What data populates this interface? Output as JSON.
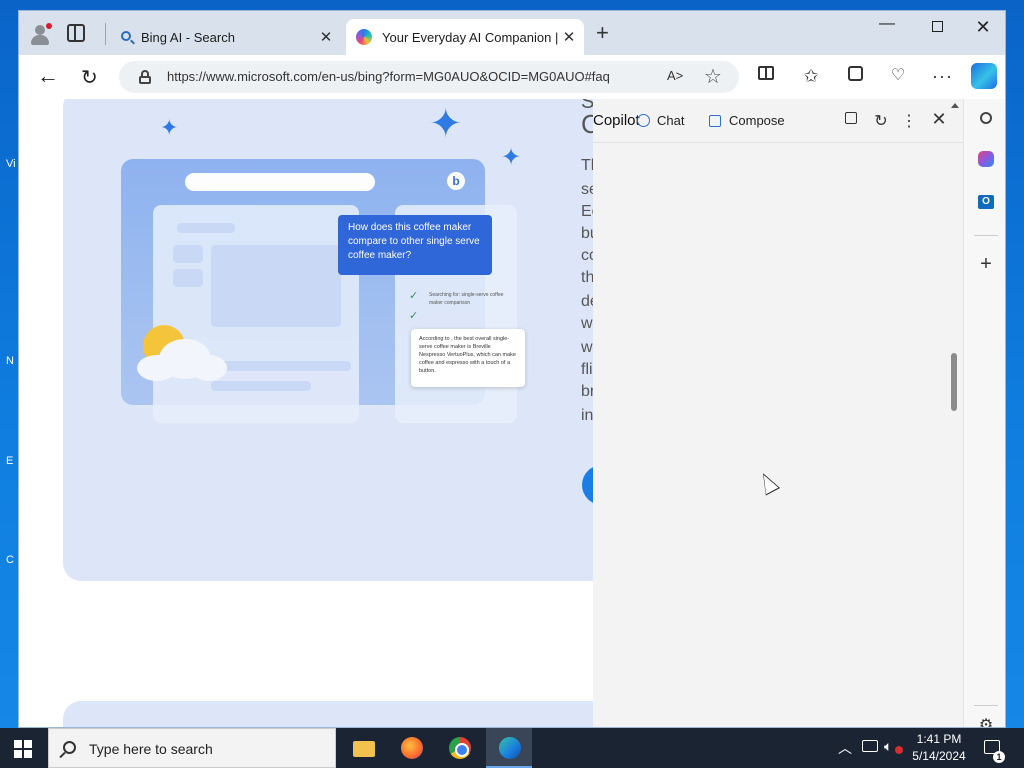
{
  "desktop": {
    "fragments": [
      "Vi",
      "N",
      "E",
      "C"
    ]
  },
  "browser": {
    "tabs": [
      {
        "title": "Bing AI - Search",
        "icon": "search-icon"
      },
      {
        "title": "Your Everyday AI Companion | M",
        "icon": "copilot-icon",
        "active": true
      }
    ],
    "new_tab": "+",
    "window_controls": {
      "minimize": "—",
      "close": "✕"
    },
    "address": {
      "url": "https://www.microsoft.com/en-us/bing?form=MG0AUO&OCID=MG0AUO#faq",
      "read_aloud": "A˃"
    }
  },
  "page": {
    "illustration": {
      "question": "How does this coffee maker compare to other single serve coffee maker?",
      "searching_1": "Searching for: single-serve coffee",
      "searching_2": "maker comparison",
      "answer": "According to , the best overall single-serve coffee maker is Breville Nespresso VertuoPlus, which can make coffee and espresso with a touch of a button.",
      "bing_letter": "b"
    },
    "text_column": [
      "S",
      "C",
      "Th",
      "se",
      "Ec",
      "bu",
      "co",
      "th",
      "de",
      "w",
      "w",
      "fli",
      "br",
      "in"
    ]
  },
  "copilot_pane": {
    "title": "Copilot",
    "tab_chat": "Chat",
    "tab_compose": "Compose"
  },
  "taskbar": {
    "search_placeholder": "Type here to search",
    "time": "1:41 PM",
    "date": "5/14/2024",
    "notification_count": "1"
  }
}
